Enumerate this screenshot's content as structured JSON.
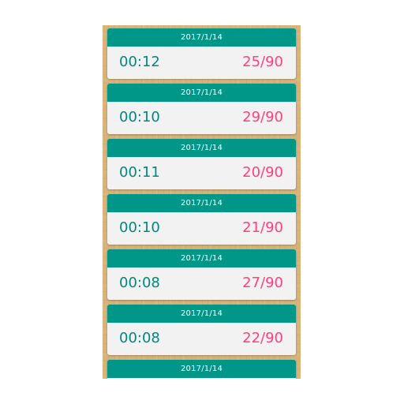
{
  "colors": {
    "header": "#009688",
    "time_text": "#00897b",
    "score_text": "#ff4081",
    "card_body": "#f2f2f2",
    "background": "#d8b37a"
  },
  "records": [
    {
      "date": "2017/1/14",
      "time": "00:12",
      "score": "25/90"
    },
    {
      "date": "2017/1/14",
      "time": "00:10",
      "score": "29/90"
    },
    {
      "date": "2017/1/14",
      "time": "00:11",
      "score": "20/90"
    },
    {
      "date": "2017/1/14",
      "time": "00:10",
      "score": "21/90"
    },
    {
      "date": "2017/1/14",
      "time": "00:08",
      "score": "27/90"
    },
    {
      "date": "2017/1/14",
      "time": "00:08",
      "score": "22/90"
    },
    {
      "date": "2017/1/14"
    }
  ]
}
